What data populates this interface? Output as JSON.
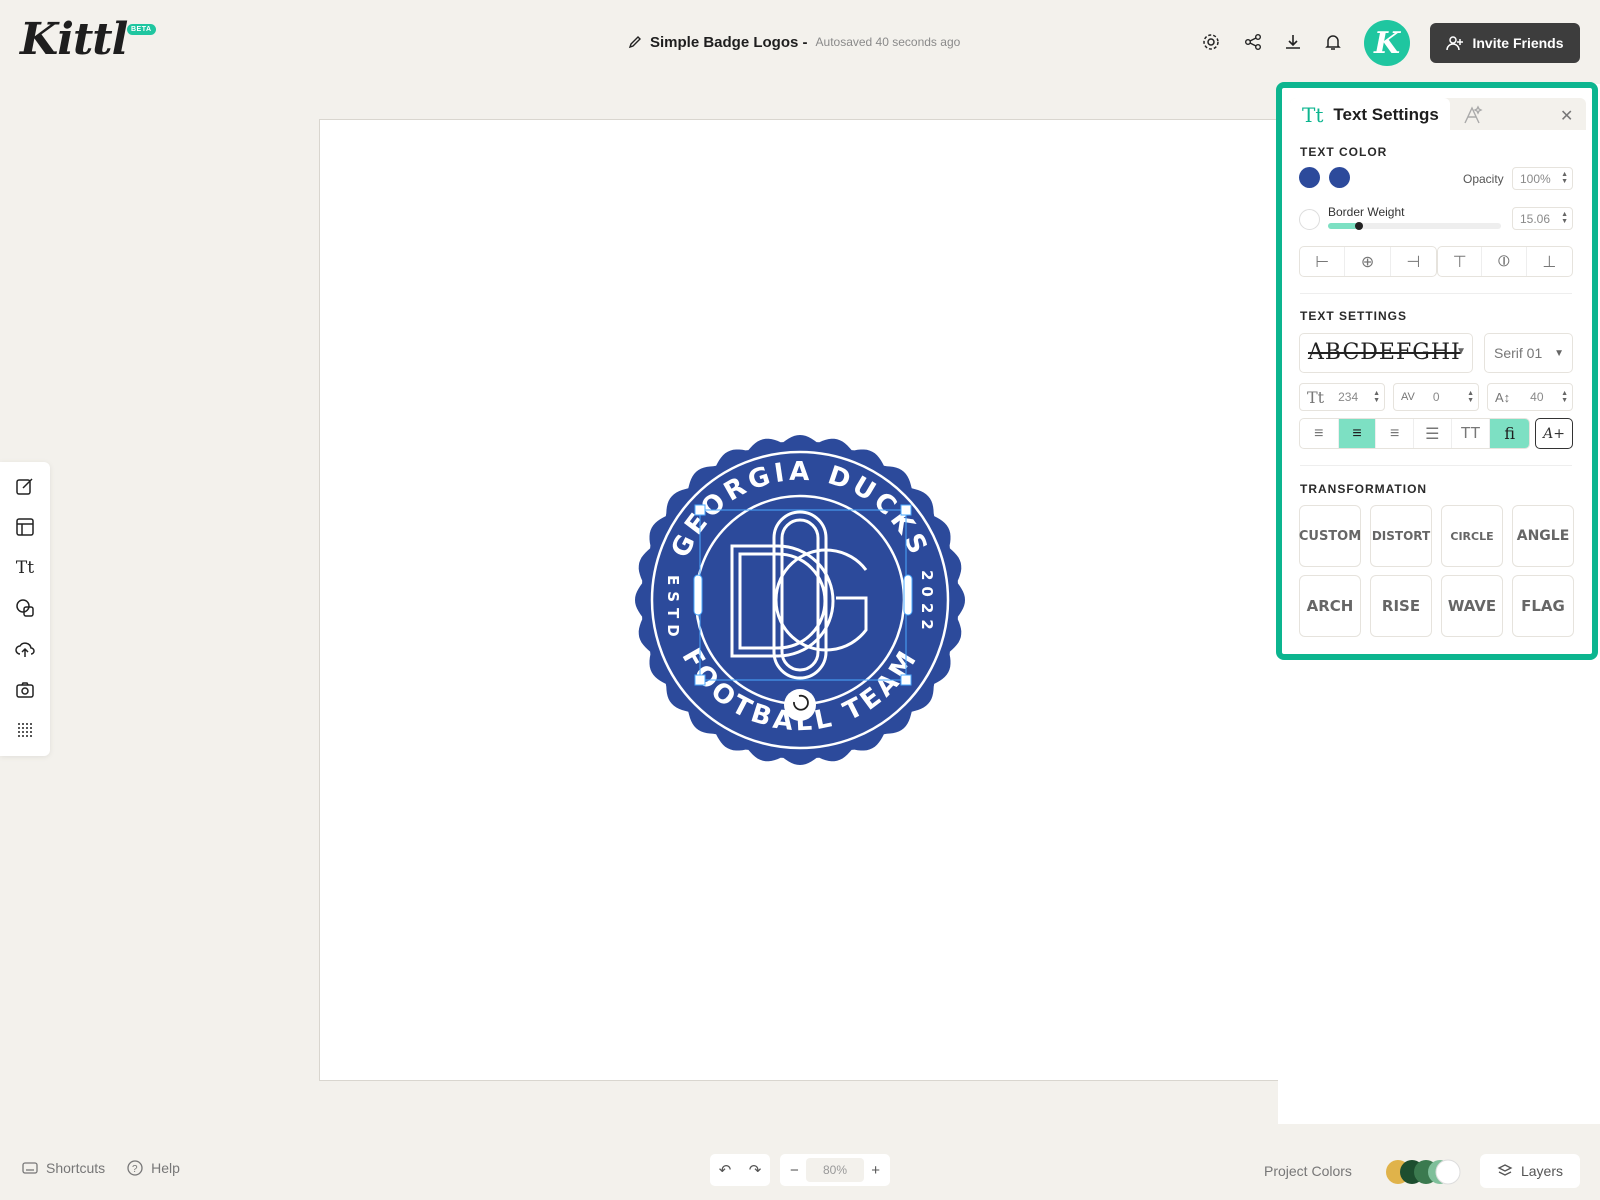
{
  "header": {
    "logo_text": "Kittl",
    "beta_label": "BETA",
    "doc_title": "Simple Badge Logos -",
    "doc_status": "Autosaved 40 seconds ago",
    "avatar_letter": "K",
    "invite_label": "Invite Friends",
    "icons": [
      "gear-icon",
      "share-icon",
      "download-icon",
      "bell-icon"
    ]
  },
  "badge": {
    "top_text": "GEORGIA DUCKS",
    "bottom_text": "FOOTBALL TEAM",
    "left_text": "ESTD",
    "right_text": "2022",
    "monogram": "DG",
    "color": "#2c4a9b"
  },
  "left_toolbar": {
    "icons": [
      "edit-icon",
      "templates-icon",
      "text-icon",
      "shapes-icon",
      "upload-icon",
      "camera-icon",
      "pattern-icon"
    ]
  },
  "panel": {
    "title": "Text Settings",
    "tab_icon": "Tt",
    "text_color_label": "TEXT COLOR",
    "colors": [
      "#2c4a9b",
      "#2c4a9b"
    ],
    "opacity_label": "Opacity",
    "opacity_value": "100%",
    "border_label": "Border Weight",
    "border_value": "15.06",
    "text_settings_label": "TEXT SETTINGS",
    "font_name": "Serif 01",
    "font_size": "234",
    "letter_spacing": "0",
    "line_height": "40",
    "transformation_label": "TRANSFORMATION",
    "transforms": [
      "CUSTOM",
      "DISTORT",
      "CIRCLE",
      "ANGLE",
      "ARCH",
      "RISE",
      "WAVE",
      "FLAG"
    ]
  },
  "footer": {
    "shortcuts_label": "Shortcuts",
    "help_label": "Help",
    "zoom_value": "80%",
    "project_colors_label": "Project Colors",
    "layers_label": "Layers"
  }
}
